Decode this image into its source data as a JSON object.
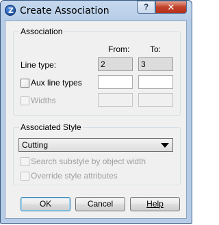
{
  "window": {
    "title": "Create Association",
    "help_button": "?",
    "close_button": "✕"
  },
  "association": {
    "group_title": "Association",
    "from_header": "From:",
    "to_header": "To:",
    "line_type_label": "Line type:",
    "line_type_from": "2",
    "line_type_to": "3",
    "aux_line_types_label": "Aux line types",
    "aux_from": "",
    "aux_to": "",
    "widths_label": "Widths",
    "widths_from": "",
    "widths_to": ""
  },
  "associated_style": {
    "group_title": "Associated Style",
    "selected": "Cutting",
    "search_substyle_label": "Search substyle by object width",
    "override_label": "Override style attributes"
  },
  "buttons": {
    "ok": "OK",
    "cancel": "Cancel",
    "help": "Help"
  }
}
